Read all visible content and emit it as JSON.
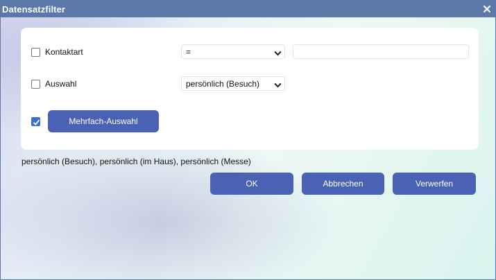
{
  "window": {
    "title": "Datensatzfilter",
    "close_icon": "close-icon"
  },
  "filters": {
    "contact_type": {
      "label": "Kontaktart",
      "checked": false,
      "operator": "=",
      "value": ""
    },
    "selection": {
      "label": "Auswahl",
      "checked": false,
      "value": "persönlich (Besuch)"
    },
    "multi": {
      "checked": true,
      "button_label": "Mehrfach-Auswahl"
    }
  },
  "summary_text": "persönlich (Besuch), persönlich (im Haus), persönlich (Messe)",
  "actions": {
    "ok": "OK",
    "cancel": "Abbrechen",
    "discard": "Verwerfen"
  },
  "colors": {
    "titlebar": "#5a78a8",
    "button": "#4a62b3",
    "checkbox_checked": "#3a6fd1"
  }
}
